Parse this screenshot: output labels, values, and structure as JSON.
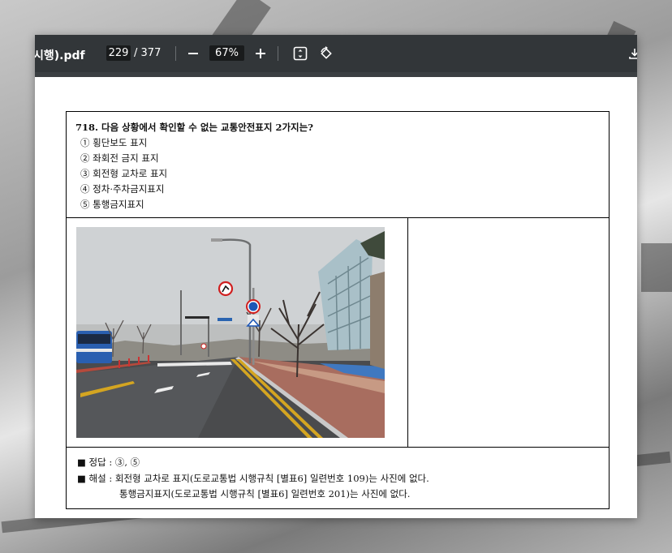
{
  "viewer": {
    "doc_title": "시행).pdf",
    "page_current": "229",
    "page_separator": "/",
    "page_total": "377",
    "zoom": "67%"
  },
  "question": {
    "title": "718. 다음 상황에서 확인할 수 없는 교통안전표지 2가지는?",
    "options": [
      "① 횡단보도 표지",
      "② 좌회전 금지 표지",
      "③ 회전형 교차로 표지",
      "④ 정차·주차금지표지",
      "⑤ 통행금지표지"
    ]
  },
  "answer": {
    "answer_line": "■  정답 : ③, ⑤",
    "explanation_line1": "■  해설 : 회전형 교차로 표지(도로교통법 시행규칙 [별표6] 일련번호 109)는 사진에 없다.",
    "explanation_line2": "통행금지표지(도로교통법 시행규칙 [별표6] 일련번호 201)는 사진에 없다."
  },
  "icons": {
    "zoom_out": "minus-icon",
    "zoom_in": "plus-icon",
    "fit": "fit-page-icon",
    "rotate": "rotate-icon",
    "download": "download-icon"
  },
  "colors": {
    "toolbar_bg": "#323639",
    "viewer_bg": "#525659",
    "input_bg": "#191b1c"
  }
}
